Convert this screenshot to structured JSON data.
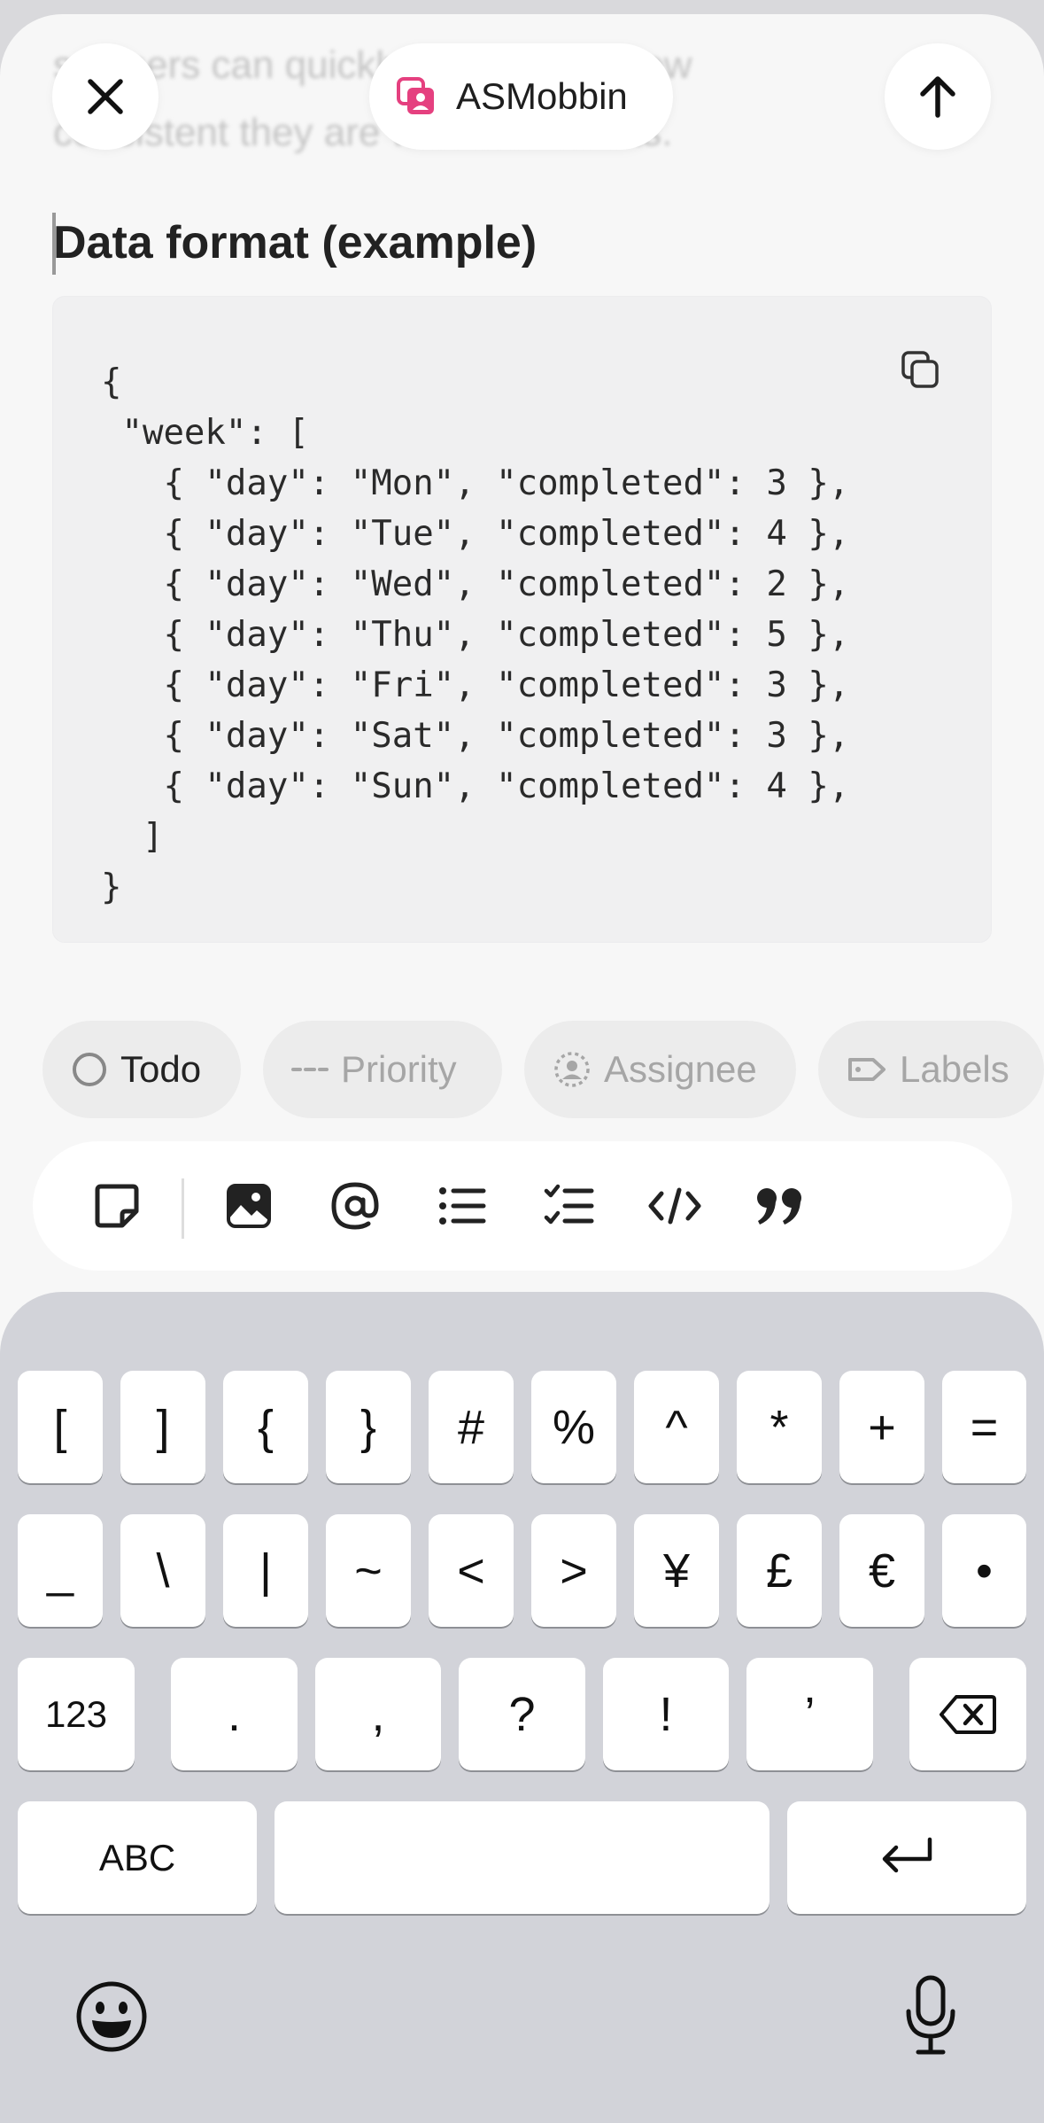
{
  "background_text": {
    "line1": "so users can quickly understand how",
    "line2": "consistent they are with their habits."
  },
  "header": {
    "close_icon": "close-icon",
    "project_label": "ASMobbin",
    "project_icon": "project-icon",
    "send_icon": "arrow-up-icon"
  },
  "editor": {
    "heading": "Data format (example)",
    "code_lines": [
      "{",
      " \"week\": [",
      "   { \"day\": \"Mon\", \"completed\": 3 },",
      "   { \"day\": \"Tue\", \"completed\": 4 },",
      "   { \"day\": \"Wed\", \"completed\": 2 },",
      "   { \"day\": \"Thu\", \"completed\": 5 },",
      "   { \"day\": \"Fri\", \"completed\": 3 },",
      "   { \"day\": \"Sat\", \"completed\": 3 },",
      "   { \"day\": \"Sun\", \"completed\": 4 },",
      "  ]",
      "}"
    ],
    "copy_icon": "copy-icon"
  },
  "properties": [
    {
      "label": "Todo",
      "icon": "status-circle-icon"
    },
    {
      "label": "Priority",
      "icon": "priority-dashes-icon"
    },
    {
      "label": "Assignee",
      "icon": "assignee-icon"
    },
    {
      "label": "Labels",
      "icon": "label-tag-icon"
    }
  ],
  "format_toolbar": [
    "sticky-note-icon",
    "image-icon",
    "mention-icon",
    "bullet-list-icon",
    "checklist-icon",
    "code-icon",
    "quote-icon"
  ],
  "keyboard": {
    "row1": [
      "[",
      "]",
      "{",
      "}",
      "#",
      "%",
      "^",
      "*",
      "+",
      "="
    ],
    "row2": [
      "_",
      "\\",
      "|",
      "~",
      "<",
      ">",
      "¥",
      "£",
      "€",
      "•"
    ],
    "row3": [
      "123",
      ".",
      ",",
      "?",
      "!",
      "’"
    ],
    "abc_label": "ABC",
    "space_label": "",
    "colors": {
      "background": "#d2d3d9",
      "key": "#ffffff"
    }
  },
  "colors": {
    "accent": "#e5407f",
    "sheet": "#f7f7f7"
  }
}
